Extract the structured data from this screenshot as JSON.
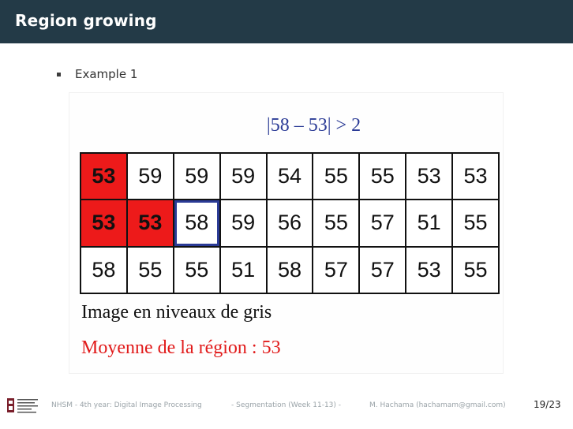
{
  "header": {
    "title": "Region growing"
  },
  "bullet": {
    "text": "Example 1"
  },
  "figure": {
    "condition": "|58 – 53| > 2",
    "grid": [
      [
        {
          "v": "53",
          "state": "region"
        },
        {
          "v": "59",
          "state": ""
        },
        {
          "v": "59",
          "state": ""
        },
        {
          "v": "59",
          "state": ""
        },
        {
          "v": "54",
          "state": ""
        },
        {
          "v": "55",
          "state": ""
        },
        {
          "v": "55",
          "state": ""
        },
        {
          "v": "53",
          "state": ""
        },
        {
          "v": "53",
          "state": ""
        }
      ],
      [
        {
          "v": "53",
          "state": "region"
        },
        {
          "v": "53",
          "state": "region"
        },
        {
          "v": "58",
          "state": "current"
        },
        {
          "v": "59",
          "state": ""
        },
        {
          "v": "56",
          "state": ""
        },
        {
          "v": "55",
          "state": ""
        },
        {
          "v": "57",
          "state": ""
        },
        {
          "v": "51",
          "state": ""
        },
        {
          "v": "55",
          "state": ""
        }
      ],
      [
        {
          "v": "58",
          "state": ""
        },
        {
          "v": "55",
          "state": ""
        },
        {
          "v": "55",
          "state": ""
        },
        {
          "v": "51",
          "state": ""
        },
        {
          "v": "58",
          "state": ""
        },
        {
          "v": "57",
          "state": ""
        },
        {
          "v": "57",
          "state": ""
        },
        {
          "v": "53",
          "state": ""
        },
        {
          "v": "55",
          "state": ""
        }
      ]
    ],
    "caption": "Image en niveaux de gris",
    "mean_label": "Moyenne de la région : 53"
  },
  "colors": {
    "header_bg": "#233a47",
    "region": "#ed1a1a",
    "accent_blue": "#2b3b96",
    "mean_text": "#e11a1a"
  },
  "footer": {
    "course": "NHSM - 4th year: Digital Image Processing",
    "section": "- Segmentation (Week 11-13) -",
    "author": "M. Hachama (hachamam@gmail.com)",
    "page": "19/23"
  }
}
